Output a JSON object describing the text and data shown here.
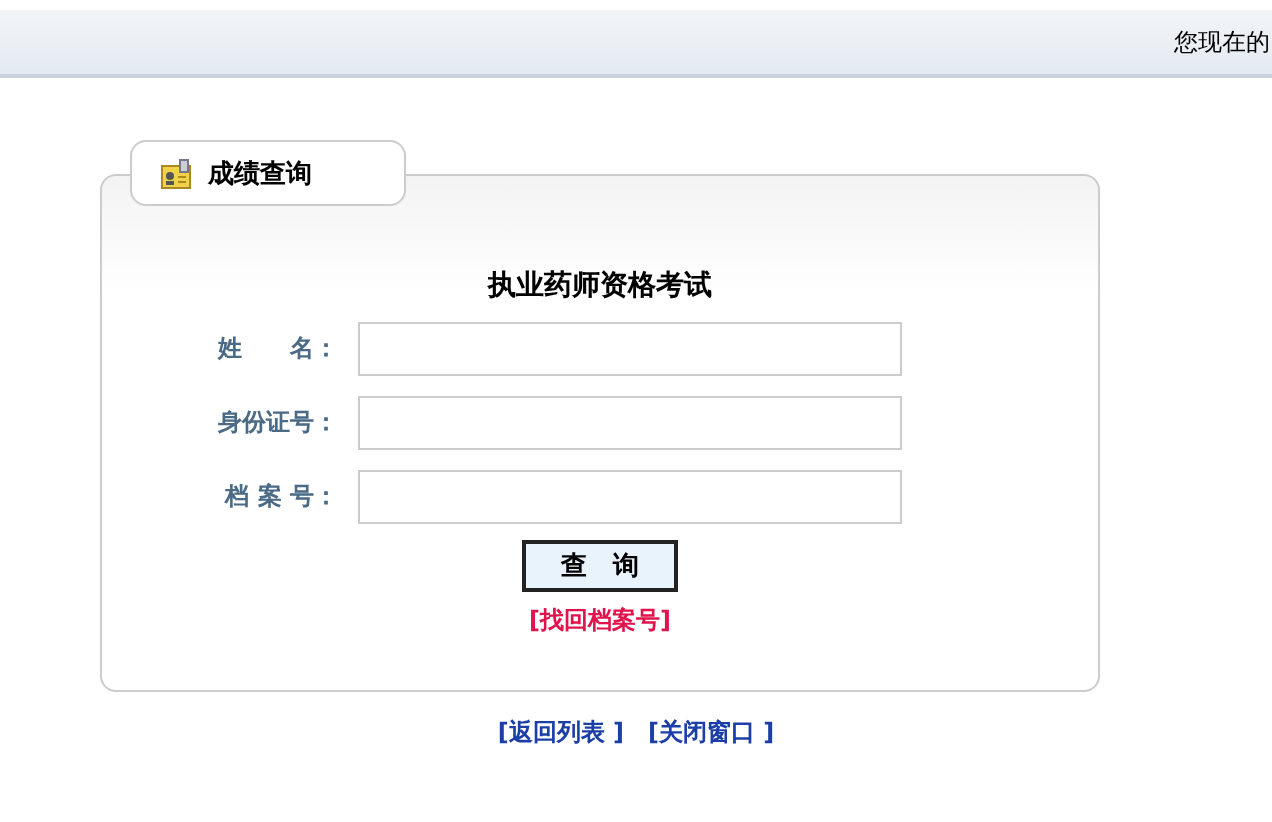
{
  "top_bar": {
    "location_text": "您现在的"
  },
  "panel": {
    "tab_title": "成绩查询",
    "heading": "执业药师资格考试",
    "fields": [
      {
        "label": "姓　　名："
      },
      {
        "label": "身份证号："
      },
      {
        "label": "档 案 号："
      }
    ],
    "submit": "查　询",
    "recover_link": "[找回档案号]"
  },
  "footer_links": [
    "[返回列表 ]",
    "[关闭窗口 ]"
  ]
}
